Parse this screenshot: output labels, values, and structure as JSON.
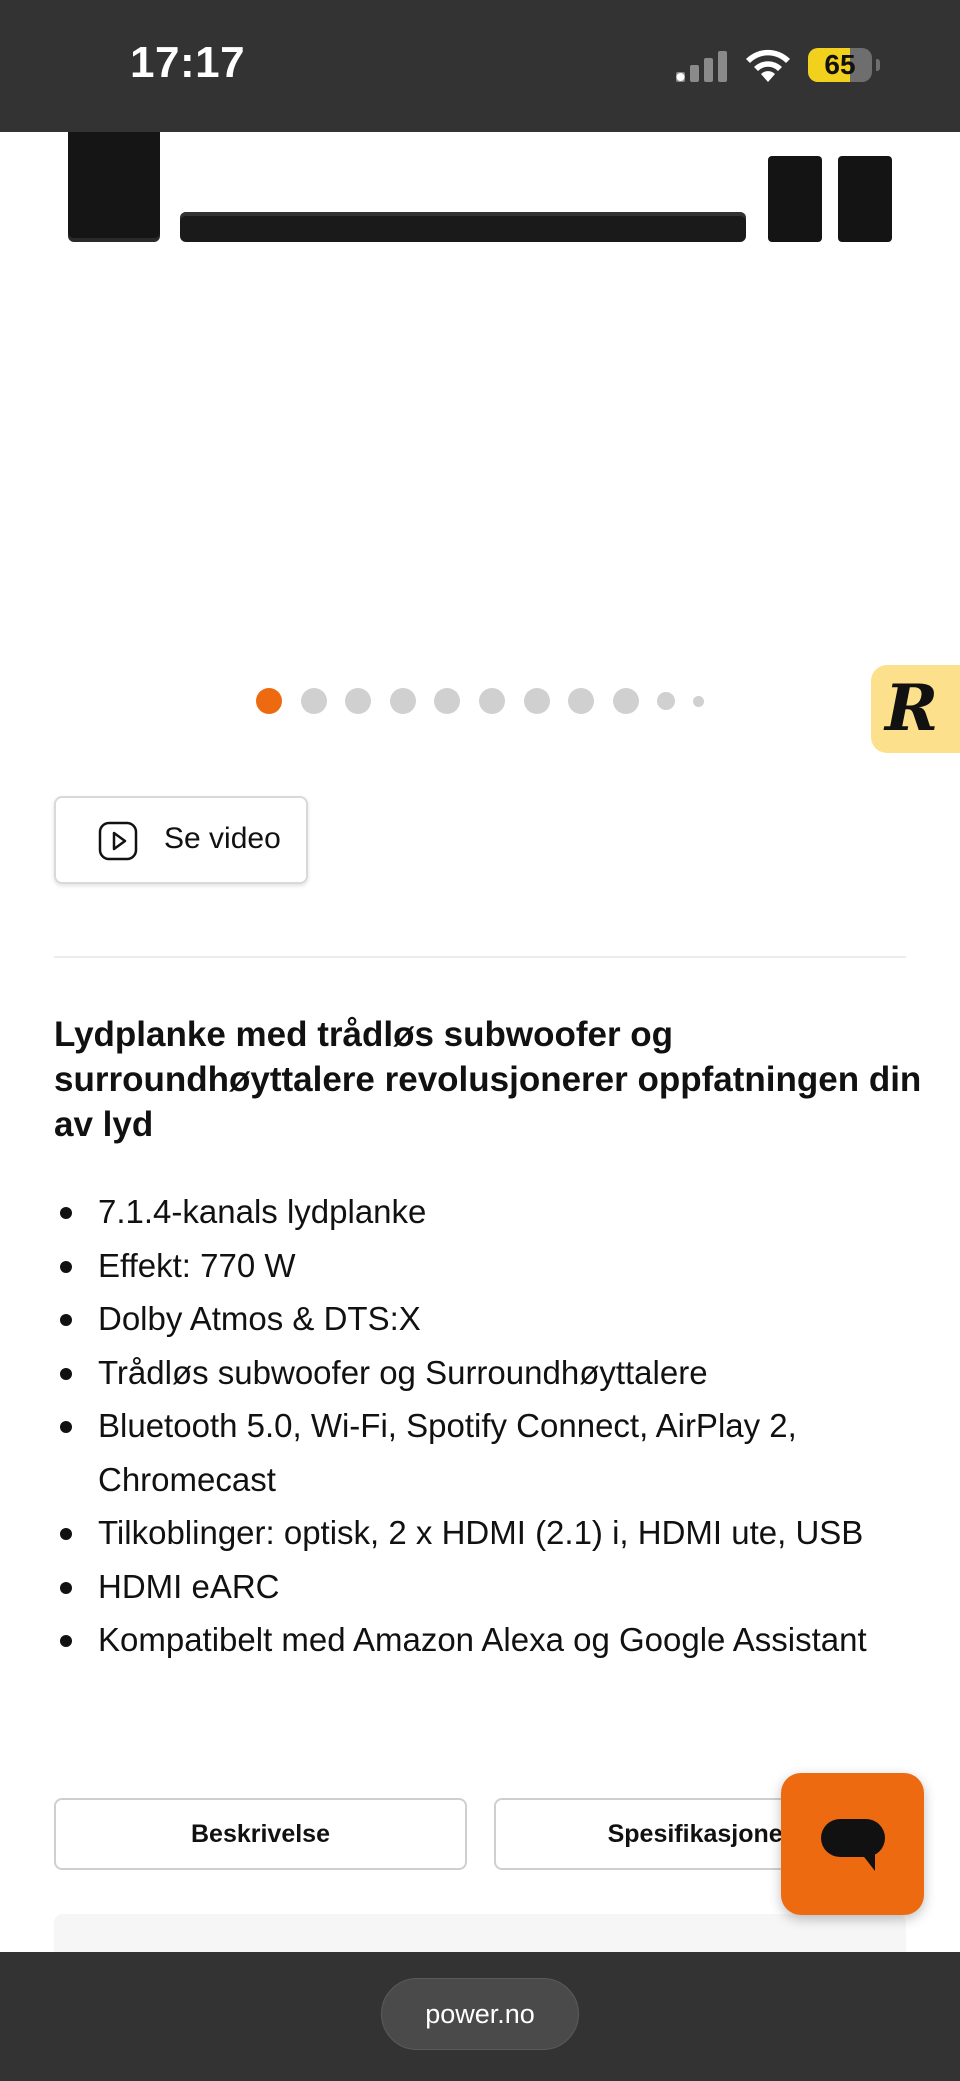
{
  "status_bar": {
    "time": "17:17",
    "battery_level": "65",
    "battery_fraction": 0.65,
    "signal_icon": "cellular-signal-icon",
    "wifi_icon": "wifi-icon",
    "battery_icon": "battery-icon"
  },
  "gallery": {
    "image_description_icon": "soundbar-system-image",
    "total_dots": 11,
    "active_index": 0,
    "accent_color": "#ee6a10"
  },
  "badge": {
    "letter": "R"
  },
  "video_button": {
    "label": "Se video",
    "icon": "play-icon"
  },
  "product": {
    "headline": "Lydplanke med trådløs subwoofer og surroundhøyttalere revolusjonerer oppfatningen din av lyd",
    "features": [
      "7.1.4-kanals lydplanke",
      "Effekt: 770 W",
      "Dolby Atmos & DTS:X",
      "Trådløs subwoofer og Surroundhøyttalere",
      "Bluetooth 5.0, Wi-Fi, Spotify Connect, AirPlay 2, Chromecast",
      "Tilkoblinger: optisk, 2 x HDMI (2.1) i, HDMI ute, USB",
      "HDMI eARC",
      "Kompatibelt med Amazon Alexa og Google Assistant"
    ]
  },
  "tabs": {
    "description": "Beskrivelse",
    "specifications": "Spesifikasjoner"
  },
  "chat": {
    "icon": "chat-bubble-icon",
    "color": "#ee6a10"
  },
  "browser": {
    "url": "power.no"
  }
}
